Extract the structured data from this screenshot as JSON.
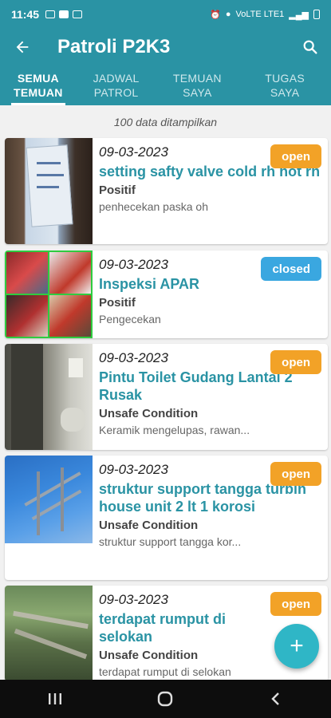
{
  "status_bar": {
    "time": "11:45",
    "network": "VoLTE LTE1"
  },
  "app_bar": {
    "title": "Patroli P2K3",
    "back_icon": "arrow-left-icon",
    "search_icon": "search-icon"
  },
  "tabs": [
    {
      "label": "SEMUA TEMUAN",
      "active": true
    },
    {
      "label": "JADWAL PATROL",
      "active": false
    },
    {
      "label": "TEMUAN SAYA",
      "active": false
    },
    {
      "label": "TUGAS SAYA",
      "active": false
    }
  ],
  "count_text": "100 data ditampilkan",
  "items": [
    {
      "date": "09-03-2023",
      "title": "setting safty valve cold rh hot rh",
      "category": "Positif",
      "description": "penhecekan paska oh",
      "status": "open"
    },
    {
      "date": "09-03-2023",
      "title": "Inspeksi APAR",
      "category": "Positif",
      "description": "Pengecekan",
      "status": "closed"
    },
    {
      "date": "09-03-2023",
      "title": "Pintu Toilet Gudang Lantai 2 Rusak",
      "category": "Unsafe Condition",
      "description": "Keramik mengelupas, rawan...",
      "status": "open"
    },
    {
      "date": "09-03-2023",
      "title": "struktur support tangga turbin house unit 2 lt 1 korosi",
      "category": "Unsafe Condition",
      "description": "struktur support tangga kor...",
      "status": "open"
    },
    {
      "date": "09-03-2023",
      "title": "terdapat rumput di selokan",
      "category": "Unsafe Condition",
      "description": "terdapat rumput di selokan",
      "status": "open"
    }
  ],
  "fab": {
    "label": "+",
    "icon": "add-icon"
  },
  "colors": {
    "primary": "#2a93a4",
    "open": "#f2a227",
    "closed": "#3aa7e0",
    "fab": "#2fb6c6"
  }
}
